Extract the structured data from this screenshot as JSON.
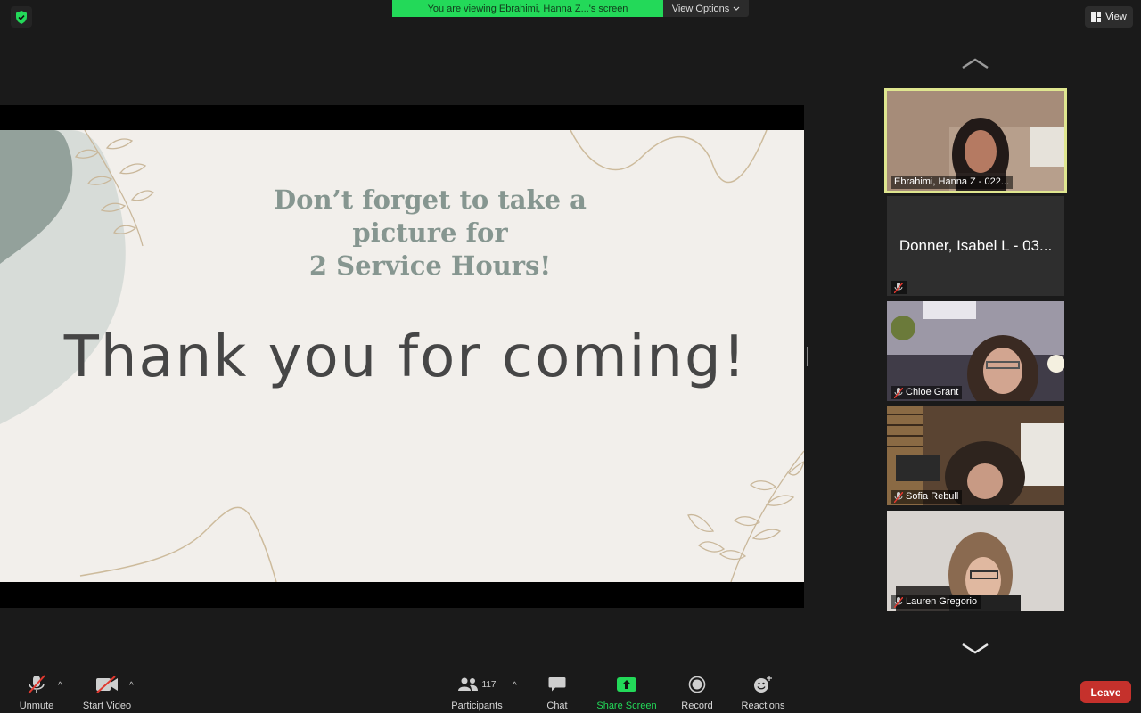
{
  "top": {
    "banner_text": "You are viewing Ebrahimi, Hanna Z...'s screen",
    "view_options_label": "View Options",
    "view_label": "View"
  },
  "slide": {
    "subtitle_line1": "Don’t forget to take a picture for",
    "subtitle_line2": "2 Service Hours!",
    "title": "Thank you for coming!"
  },
  "gallery": {
    "tiles": [
      {
        "name": "Ebrahimi, Hanna Z - 022...",
        "muted": false,
        "video": true,
        "active": true
      },
      {
        "name": "Donner, Isabel L - 03...",
        "muted": true,
        "video": false,
        "active": false
      },
      {
        "name": "Chloe Grant",
        "muted": true,
        "video": true,
        "active": false
      },
      {
        "name": "Sofia Rebull",
        "muted": true,
        "video": true,
        "active": false
      },
      {
        "name": "Lauren Gregorio",
        "muted": true,
        "video": true,
        "active": false
      }
    ]
  },
  "toolbar": {
    "unmute_label": "Unmute",
    "start_video_label": "Start Video",
    "participants_label": "Participants",
    "participants_count": "117",
    "chat_label": "Chat",
    "share_screen_label": "Share Screen",
    "record_label": "Record",
    "reactions_label": "Reactions",
    "leave_label": "Leave"
  },
  "colors": {
    "share_green": "#23d959",
    "leave_red": "#c5312c",
    "active_speaker_outline": "#dfe68f",
    "slide_background": "#f2efeb"
  }
}
